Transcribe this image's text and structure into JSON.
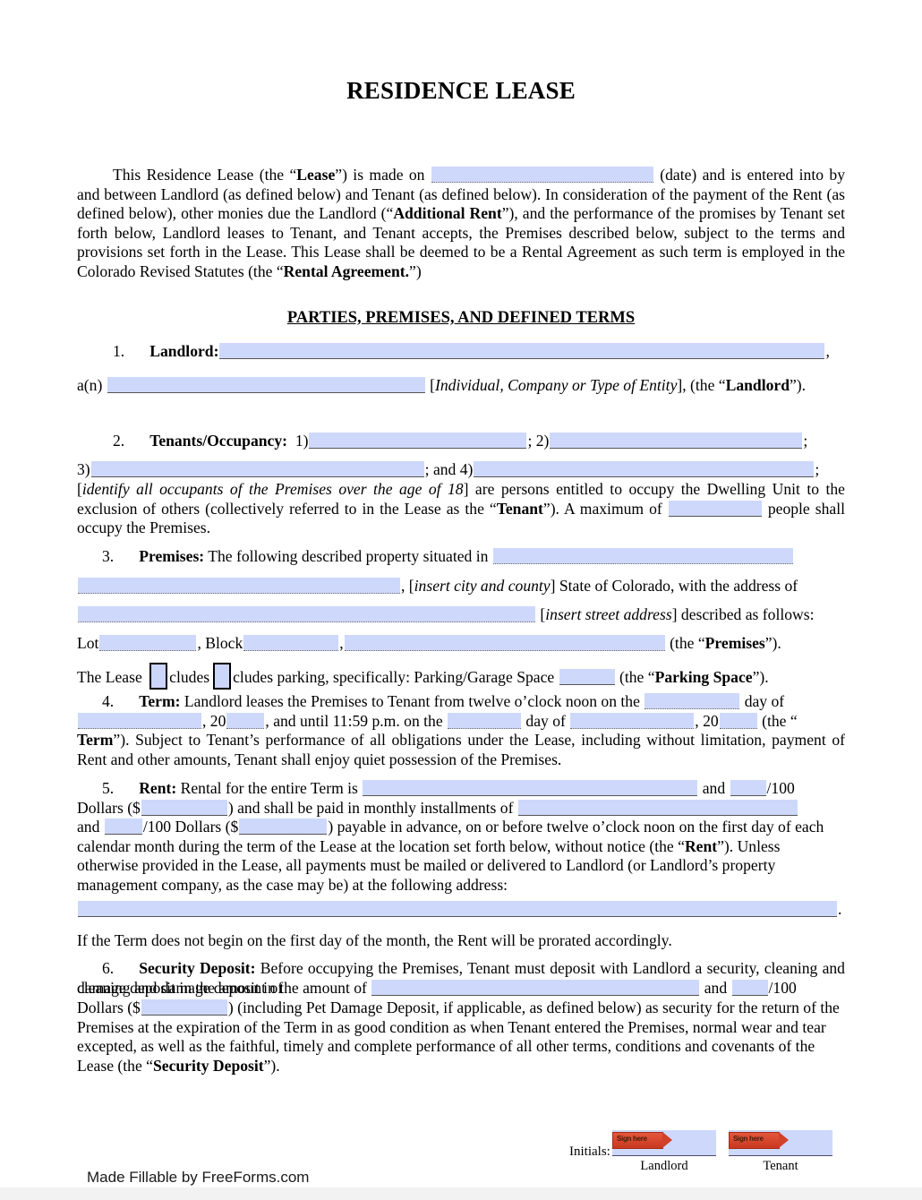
{
  "document": {
    "title": "RESIDENCE LEASE",
    "section_heading": "PARTIES, PREMISES, AND DEFINED TERMS"
  },
  "intro": {
    "t1": "This Residence Lease (the “",
    "b1": "Lease",
    "t2": "”) is made on ",
    "t3": " (date) and is entered into by and between Landlord (as defined below) and Tenant (as defined below). In consideration of the payment of the Rent (as defined below), other monies due the Landlord (“",
    "b2": "Additional Rent",
    "t4": "”), and the performance of the promises by Tenant set forth below, Landlord leases to Tenant, and Tenant accepts, the Premises described below, subject to the terms and provisions set forth in the Lease. This Lease shall be deemed to be a Rental Agreement as such term is employed in the Colorado Revised Statutes (the “",
    "b3": "Rental Agreement.",
    "t5": "”)"
  },
  "clause1": {
    "number": "1.",
    "label": "Landlord:",
    "comma": ",",
    "an": "a(n) ",
    "bracket": "[",
    "entity_italic": "Individual, Company or Type of Entity",
    "close": "], (the “",
    "bold_landlord": "Landlord",
    "tail": "”)."
  },
  "clause2": {
    "number": "2.",
    "label": "Tenants/Occupancy:",
    "n1": "1)",
    "sep1": "; 2)",
    "sep2": ";",
    "n3": "3)",
    "sep3": "; and 4)",
    "sep4": ";",
    "italic_note": "identify all occupants of the Premises over the age of 18",
    "text_a": "] are persons entitled to occupy the Dwelling Unit to the exclusion of others (collectively referred to in the Lease as the “",
    "bold_tenant": "Tenant",
    "text_b": "”). A maximum of ",
    "text_c": " people shall occupy the Premises."
  },
  "clause3": {
    "number": "3.",
    "label": "Premises:",
    "text_a": "The following described property situated in ",
    "comma": ", ",
    "bracket_open": "[",
    "italic_city": "insert city and county",
    "text_b": "] State of Colorado, with the address of ",
    "italic_street": "insert street address",
    "text_c": "] described as follows:",
    "lot": "Lot",
    "block": ", Block",
    "comma2": ",",
    "premises_tail_open": "(the “",
    "premises_bold": "Premises",
    "premises_tail_close": "”).",
    "lease_text": "The Lease ",
    "includes": "cludes",
    "excludes": "cludes parking, specifically: Parking/Garage Space ",
    "parking_open": "(the “",
    "parking_bold": "Parking Space",
    "parking_close": "”)."
  },
  "clause4": {
    "number": "4.",
    "label": "Term:",
    "text_a": "Landlord leases the Premises to Tenant from twelve o’clock noon on the ",
    "text_b": " day of ",
    "text_c": ", 20",
    "text_d": ", and until 11:59 p.m. on the ",
    "text_e": " day of ",
    "text_f": ", 20",
    "text_g": " (the “",
    "bold_term": "Term",
    "text_h": "”). Subject to Tenant’s performance of all obligations under the Lease, including without limitation, payment of Rent and other amounts, Tenant shall enjoy quiet possession of the Premises."
  },
  "clause5": {
    "number": "5.",
    "label": "Rent:",
    "text_a": "Rental for the entire Term is ",
    "text_b": " and ",
    "text_c": "/100 Dollars ($",
    "text_d": ") and shall be paid in monthly installments of ",
    "text_e": "and ",
    "text_f": "/100 Dollars ($",
    "text_g": ") payable in advance, on or before twelve o’clock noon on the first day of each calendar month during the term of the Lease at the location set forth below, without notice (the “",
    "bold_rent": "Rent",
    "text_h": "”). Unless otherwise provided in the Lease, all payments must be mailed or delivered to Landlord (or Landlord’s property management company, as the case may be) at the following address:",
    "period": ".",
    "prorate": "If the Term does not begin on the first day of the month, the Rent will be prorated accordingly."
  },
  "clause6": {
    "number": "6.",
    "label": "Security Deposit:",
    "text_a": "Before occupying the Premises, Tenant must deposit with Landlord a security, cleaning and damage deposit in the amount of ",
    "text_b": " and ",
    "text_c": "/100 Dollars ($",
    "text_d": ") (including Pet Damage Deposit, if applicable, as defined below) as security for the return of the Premises at the expiration of the Term in as good condition as when Tenant entered the Premises, normal wear and tear excepted, as well as the faithful, timely and complete performance of all other terms, conditions and covenants of the Lease (the “",
    "bold_sd": "Security Deposit",
    "text_e": "”)."
  },
  "footer": {
    "initials_label": "Initials:",
    "landlord_caption": "Landlord",
    "tenant_caption": "Tenant",
    "sign_tag_text": "Sign here",
    "made_fillable": "Made Fillable by FreeForms.com"
  },
  "colors": {
    "field_fill": "#ced8fb",
    "sign_tag": "#d2402a",
    "text": "#000000"
  }
}
